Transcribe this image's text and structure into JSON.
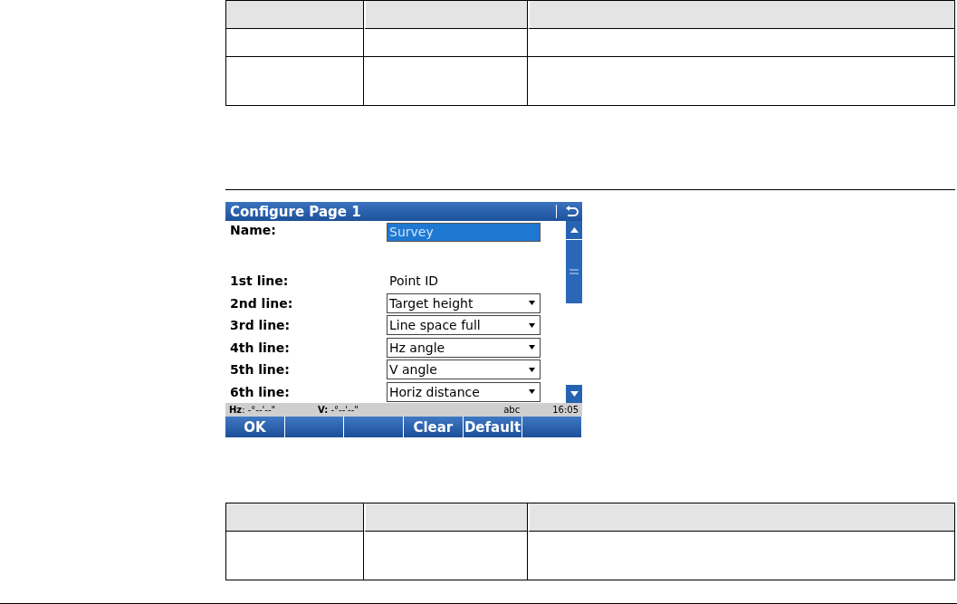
{
  "top_table": {
    "rows": [
      {
        "kind": "header"
      },
      {
        "kind": "single"
      },
      {
        "kind": "double"
      }
    ]
  },
  "device_screen": {
    "title": "Configure Page 1",
    "name_field": {
      "label": "Name:",
      "value": "Survey",
      "selected": true
    },
    "lines": [
      {
        "kind": "static",
        "label": "1st line:",
        "value": "Point ID"
      },
      {
        "kind": "dropdown",
        "label": "2nd line:",
        "value": "Target height"
      },
      {
        "kind": "dropdown",
        "label": "3rd line:",
        "value": "Line space full"
      },
      {
        "kind": "dropdown",
        "label": "4th line:",
        "value": "Hz angle"
      },
      {
        "kind": "dropdown",
        "label": "5th line:",
        "value": "V angle"
      },
      {
        "kind": "dropdown",
        "label": "6th line:",
        "value": "Horiz distance"
      }
    ],
    "status_bar": {
      "hz_label": "Hz",
      "hz_value": ": -°--'--\"",
      "v_label": "V:",
      "v_value": "-°--'--\"",
      "input_mode": "abc",
      "time": "16:05"
    },
    "softkeys": [
      {
        "kind": "key",
        "label": "OK"
      },
      {
        "kind": "blank"
      },
      {
        "kind": "blank"
      },
      {
        "kind": "key",
        "label": "Clear"
      },
      {
        "kind": "key",
        "label": "Default"
      },
      {
        "kind": "blank"
      }
    ]
  },
  "bottom_table": {
    "rows": [
      {
        "kind": "header"
      },
      {
        "kind": "double"
      }
    ]
  }
}
